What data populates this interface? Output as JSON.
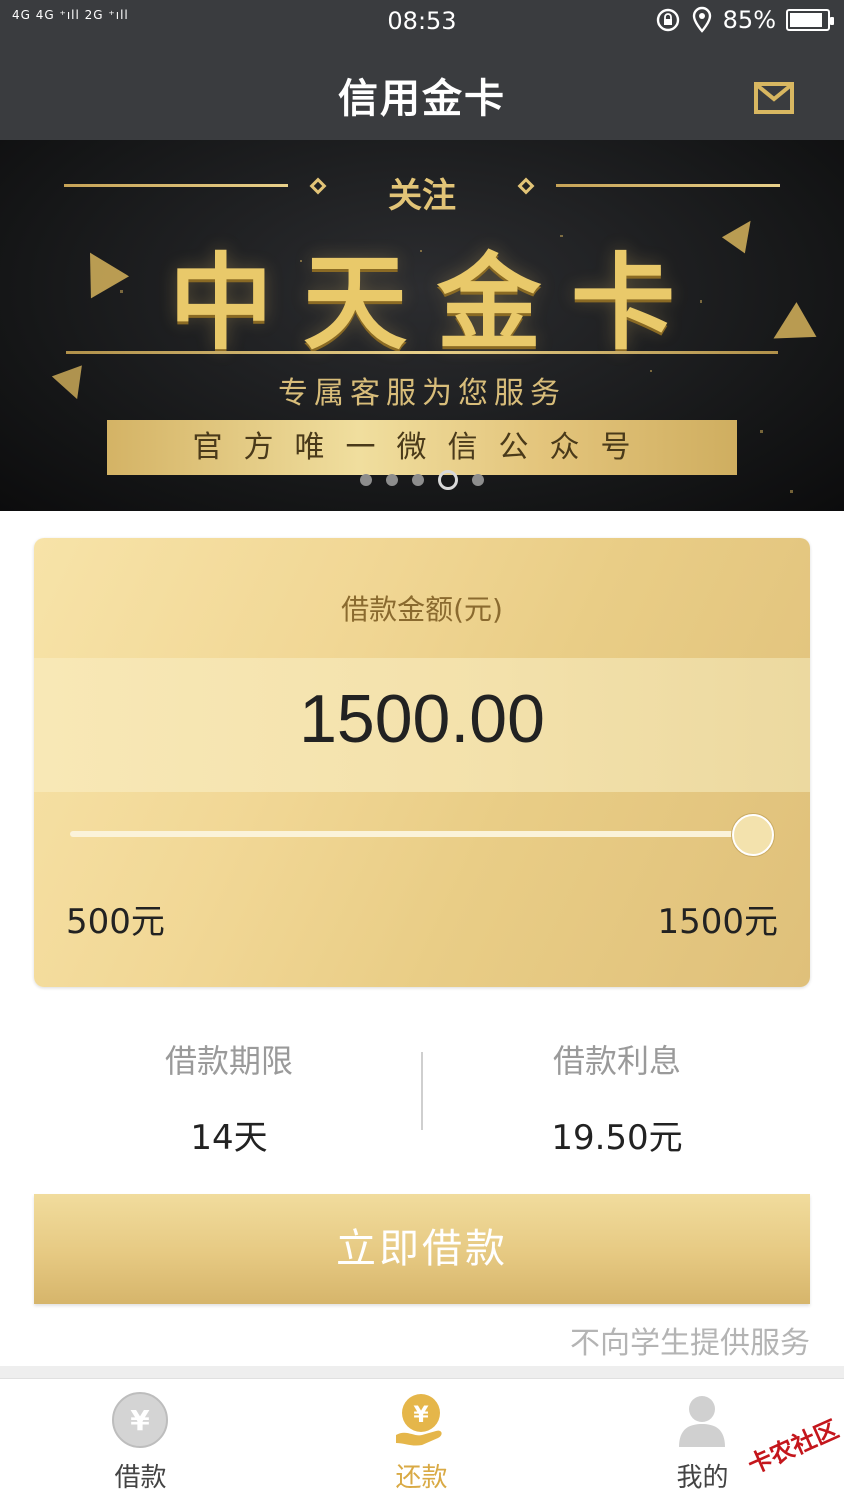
{
  "status_bar": {
    "signal_text": "4G 4G ⁺ıll 2G ⁺ıll",
    "time": "08:53",
    "battery_percent": "85%",
    "icons": [
      "rotation-lock-icon",
      "location-icon",
      "battery-icon"
    ]
  },
  "header": {
    "title": "信用金卡",
    "mail_icon": "mail-icon"
  },
  "banner": {
    "follow_text": "关注",
    "headline": "中天金卡",
    "subtitle": "专属客服为您服务",
    "strip_text": "官方唯一微信公众号",
    "carousel": {
      "count": 5,
      "active_index": 3
    }
  },
  "loan_card": {
    "label": "借款金额(元)",
    "amount": "1500.00",
    "slider": {
      "min": 500,
      "max": 1500,
      "value": 1500
    },
    "min_label": "500元",
    "max_label": "1500元"
  },
  "info": {
    "term_title": "借款期限",
    "term_value": "14天",
    "interest_title": "借款利息",
    "interest_value": "19.50元"
  },
  "borrow_button": "立即借款",
  "notice": "不向学生提供服务",
  "nav": {
    "items": [
      {
        "label": "借款",
        "icon": "yen-circle-icon"
      },
      {
        "label": "还款",
        "icon": "yen-hand-icon",
        "active": true
      },
      {
        "label": "我的",
        "icon": "user-icon"
      }
    ]
  },
  "watermark": "卡农社区",
  "colors": {
    "header_bg": "#3a3c3f",
    "gold": "#d9aa45",
    "card_gold": "#f1d795"
  }
}
